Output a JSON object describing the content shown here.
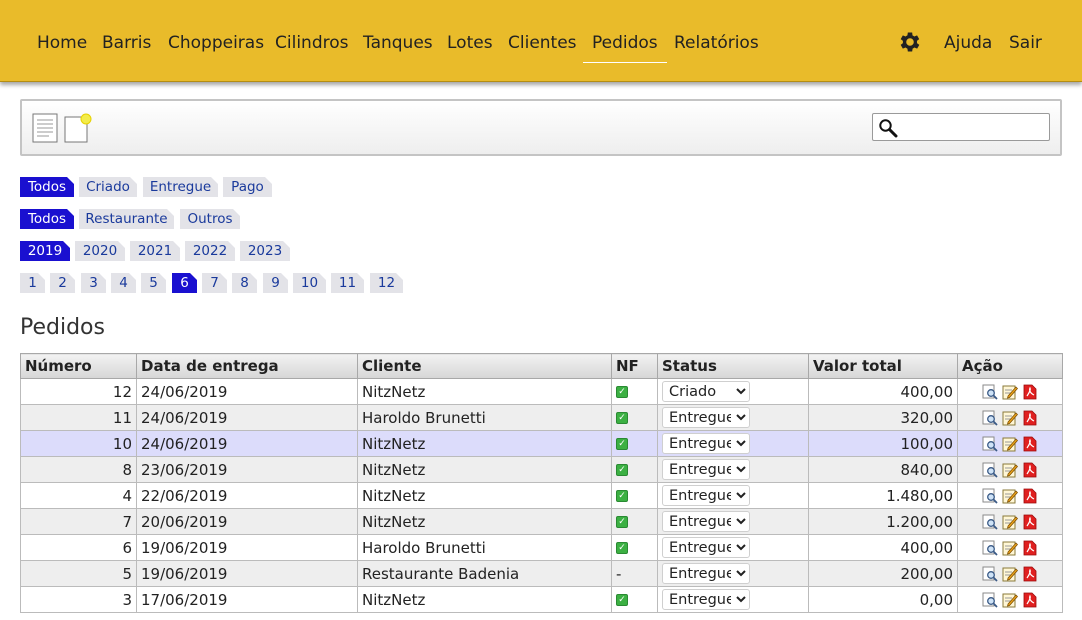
{
  "nav": {
    "items": [
      {
        "label": "Home",
        "active": false
      },
      {
        "label": "Barris",
        "active": false
      },
      {
        "label": "Choppeiras",
        "active": false
      },
      {
        "label": "Cilindros",
        "active": false
      },
      {
        "label": "Tanques",
        "active": false
      },
      {
        "label": "Lotes",
        "active": false
      },
      {
        "label": "Clientes",
        "active": false
      },
      {
        "label": "Pedidos",
        "active": true
      },
      {
        "label": "Relatórios",
        "active": false
      }
    ],
    "settings_icon": "gear-icon",
    "help_label": "Ajuda",
    "logout_label": "Sair"
  },
  "toolbar": {
    "list_icon": "document-list-icon",
    "new_icon": "new-document-icon",
    "search": {
      "value": "",
      "placeholder": "",
      "icon": "search-icon"
    }
  },
  "filters": {
    "status": {
      "options": [
        "Todos",
        "Criado",
        "Entregue",
        "Pago"
      ],
      "selected": "Todos"
    },
    "client_type": {
      "options": [
        "Todos",
        "Restaurante",
        "Outros"
      ],
      "selected": "Todos"
    },
    "year": {
      "options": [
        "2019",
        "2020",
        "2021",
        "2022",
        "2023"
      ],
      "selected": "2019"
    },
    "month": {
      "options": [
        "1",
        "2",
        "3",
        "4",
        "5",
        "6",
        "7",
        "8",
        "9",
        "10",
        "11",
        "12"
      ],
      "selected": "6"
    }
  },
  "page_title": "Pedidos",
  "table": {
    "columns": [
      "Número",
      "Data de entrega",
      "Cliente",
      "NF",
      "Status",
      "Valor total",
      "Ação"
    ],
    "rows": [
      {
        "numero": "12",
        "data": "24/06/2019",
        "cliente": "NitzNetz",
        "nf": true,
        "status": "Criado",
        "valor": "400,00"
      },
      {
        "numero": "11",
        "data": "24/06/2019",
        "cliente": "Haroldo Brunetti",
        "nf": true,
        "status": "Entregue",
        "valor": "320,00"
      },
      {
        "numero": "10",
        "data": "24/06/2019",
        "cliente": "NitzNetz",
        "nf": true,
        "status": "Entregue",
        "valor": "100,00"
      },
      {
        "numero": "8",
        "data": "23/06/2019",
        "cliente": "NitzNetz",
        "nf": true,
        "status": "Entregue",
        "valor": "840,00"
      },
      {
        "numero": "4",
        "data": "22/06/2019",
        "cliente": "NitzNetz",
        "nf": true,
        "status": "Entregue",
        "valor": "1.480,00"
      },
      {
        "numero": "7",
        "data": "20/06/2019",
        "cliente": "NitzNetz",
        "nf": true,
        "status": "Entregue",
        "valor": "1.200,00"
      },
      {
        "numero": "6",
        "data": "19/06/2019",
        "cliente": "Haroldo Brunetti",
        "nf": true,
        "status": "Entregue",
        "valor": "400,00"
      },
      {
        "numero": "5",
        "data": "19/06/2019",
        "cliente": "Restaurante Badenia",
        "nf": false,
        "nf_text": "-",
        "status": "Entregue",
        "valor": "200,00"
      },
      {
        "numero": "3",
        "data": "17/06/2019",
        "cliente": "NitzNetz",
        "nf": true,
        "status": "Entregue",
        "valor": "0,00"
      }
    ],
    "highlighted_row": 2,
    "status_options": [
      "Criado",
      "Entregue",
      "Pago"
    ],
    "action_icons": [
      "view-icon",
      "edit-icon",
      "pdf-icon"
    ]
  },
  "colors": {
    "header_bg": "#e9bb2a",
    "chip_selected": "#1a10d0",
    "chip_text": "#1a3a9c",
    "row_highlight": "#dcdcfb"
  }
}
